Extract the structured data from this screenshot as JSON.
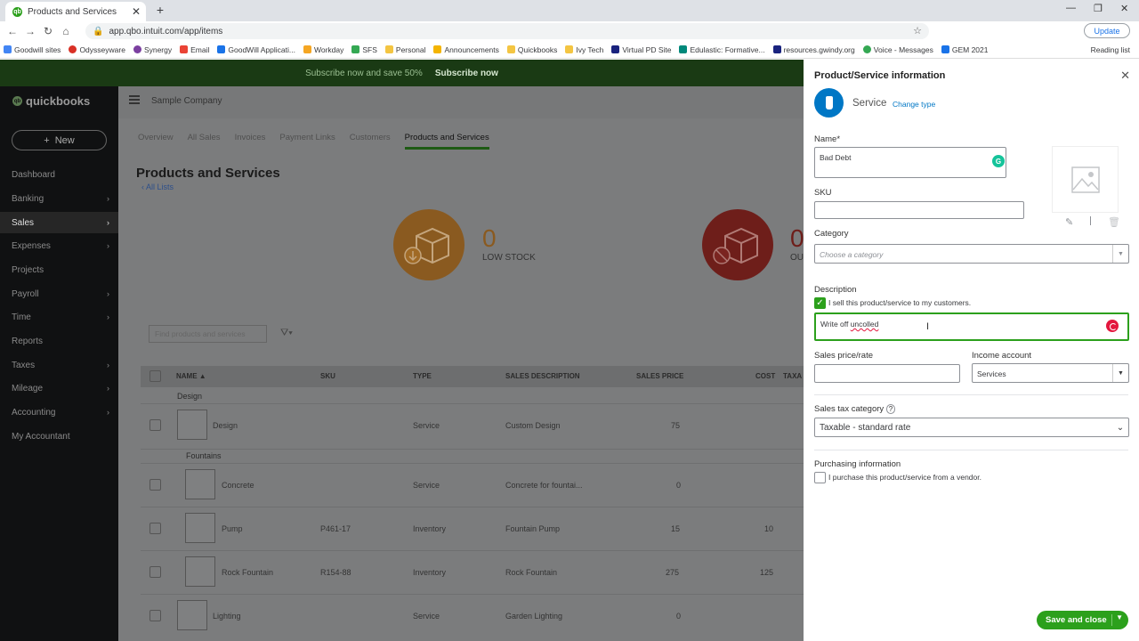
{
  "browser": {
    "tab_title": "Products and Services",
    "url": "app.qbo.intuit.com/app/items",
    "update_label": "Update",
    "bookmarks": [
      "Goodwill sites",
      "Odysseyware",
      "Synergy",
      "Email",
      "GoodWill Applicati...",
      "Workday",
      "SFS",
      "Personal",
      "Announcements",
      "Quickbooks",
      "Ivy Tech",
      "Virtual PD Site",
      "Edulastic: Formative...",
      "resources.gwindy.org",
      "Voice - Messages",
      "GEM 2021"
    ],
    "reading_list": "Reading list"
  },
  "promo": {
    "text": "Subscribe now and save 50%",
    "cta": "Subscribe now"
  },
  "sidebar": {
    "logo": "quickbooks",
    "new_label": "New",
    "items": [
      "Dashboard",
      "Banking",
      "Sales",
      "Expenses",
      "Projects",
      "Payroll",
      "Time",
      "Reports",
      "Taxes",
      "Mileage",
      "Accounting",
      "My Accountant"
    ],
    "active": "Sales"
  },
  "main": {
    "company": "Sample Company",
    "tabs": [
      "Overview",
      "All Sales",
      "Invoices",
      "Payment Links",
      "Customers",
      "Products and Services"
    ],
    "title": "Products and Services",
    "all_lists": "All Lists",
    "low_stock_count": "0",
    "low_stock_label": "LOW STOCK",
    "out_count": "0",
    "out_label": "OU",
    "search_placeholder": "Find products and services",
    "columns": [
      "NAME ▲",
      "SKU",
      "TYPE",
      "SALES DESCRIPTION",
      "SALES PRICE",
      "COST",
      "TAXA"
    ],
    "groups": [
      "Design",
      "Fountains"
    ],
    "rows": [
      {
        "name": "Design",
        "sku": "",
        "type": "Service",
        "desc": "Custom Design",
        "price": "75",
        "cost": ""
      },
      {
        "name": "Concrete",
        "sku": "",
        "type": "Service",
        "desc": "Concrete for fountai...",
        "price": "0",
        "cost": ""
      },
      {
        "name": "Pump",
        "sku": "P461-17",
        "type": "Inventory",
        "desc": "Fountain Pump",
        "price": "15",
        "cost": "10"
      },
      {
        "name": "Rock Fountain",
        "sku": "R154-88",
        "type": "Inventory",
        "desc": "Rock Fountain",
        "price": "275",
        "cost": "125"
      },
      {
        "name": "Lighting",
        "sku": "",
        "type": "Service",
        "desc": "Garden Lighting",
        "price": "0",
        "cost": ""
      }
    ]
  },
  "panel": {
    "title": "Product/Service information",
    "type": "Service",
    "change_type": "Change type",
    "name_label": "Name*",
    "name_value": "Bad Debt",
    "sku_label": "SKU",
    "sku_value": "",
    "category_label": "Category",
    "category_placeholder": "Choose a category",
    "description_label": "Description",
    "sell_label": "I sell this product/service to my customers.",
    "description_prefix": "Write off ",
    "description_misspelled": "uncolled",
    "sales_price_label": "Sales price/rate",
    "sales_price_value": "",
    "income_account_label": "Income account",
    "income_account_value": "Services",
    "sales_tax_label": "Sales tax category",
    "sales_tax_value": "Taxable - standard rate",
    "purchasing_label": "Purchasing information",
    "purchase_label": "I purchase this product/service from a vendor.",
    "save_label": "Save and close"
  }
}
